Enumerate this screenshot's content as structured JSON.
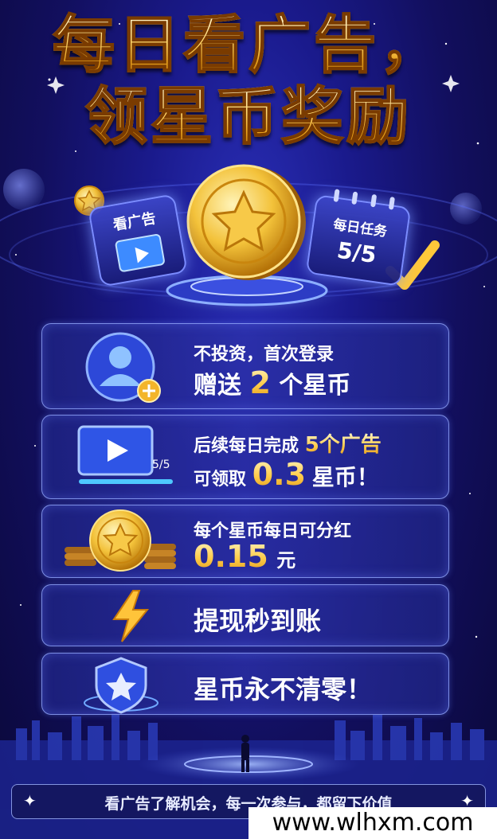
{
  "header": {
    "title_line1": "每日看广告，",
    "title_line2": "领星币奖励"
  },
  "hero": {
    "ad_card_label": "看广告",
    "task_card_label": "每日任务",
    "task_progress": "5/5"
  },
  "rows": [
    {
      "line1": "不投资，首次登录",
      "line2_prefix": "赠送",
      "line2_highlight": "2",
      "line2_suffix": "个星币",
      "icon": "user-plus-icon"
    },
    {
      "line1_prefix": "后续每日完成",
      "line1_highlight": "5个广告",
      "line2_prefix": "可领取",
      "line2_highlight": "0.3",
      "line2_suffix": "星币！",
      "icon": "video-screen-icon",
      "progress": "5/5"
    },
    {
      "line1": "每个星币每日可分红",
      "line2_highlight": "0.15",
      "line2_suffix": "元",
      "icon": "coin-stack-icon"
    },
    {
      "line1": "提现秒到账",
      "icon": "lightning-icon"
    },
    {
      "line1": "星币永不清零！",
      "icon": "shield-star-icon"
    }
  ],
  "footer": {
    "slogan": "看广告了解机会，每一次参与，都留下价值"
  },
  "watermark": "www.wlhxm.com",
  "colors": {
    "background": "#1a1a8c",
    "gold": "#ffcc4a",
    "panel_border": "#7b8cff"
  }
}
